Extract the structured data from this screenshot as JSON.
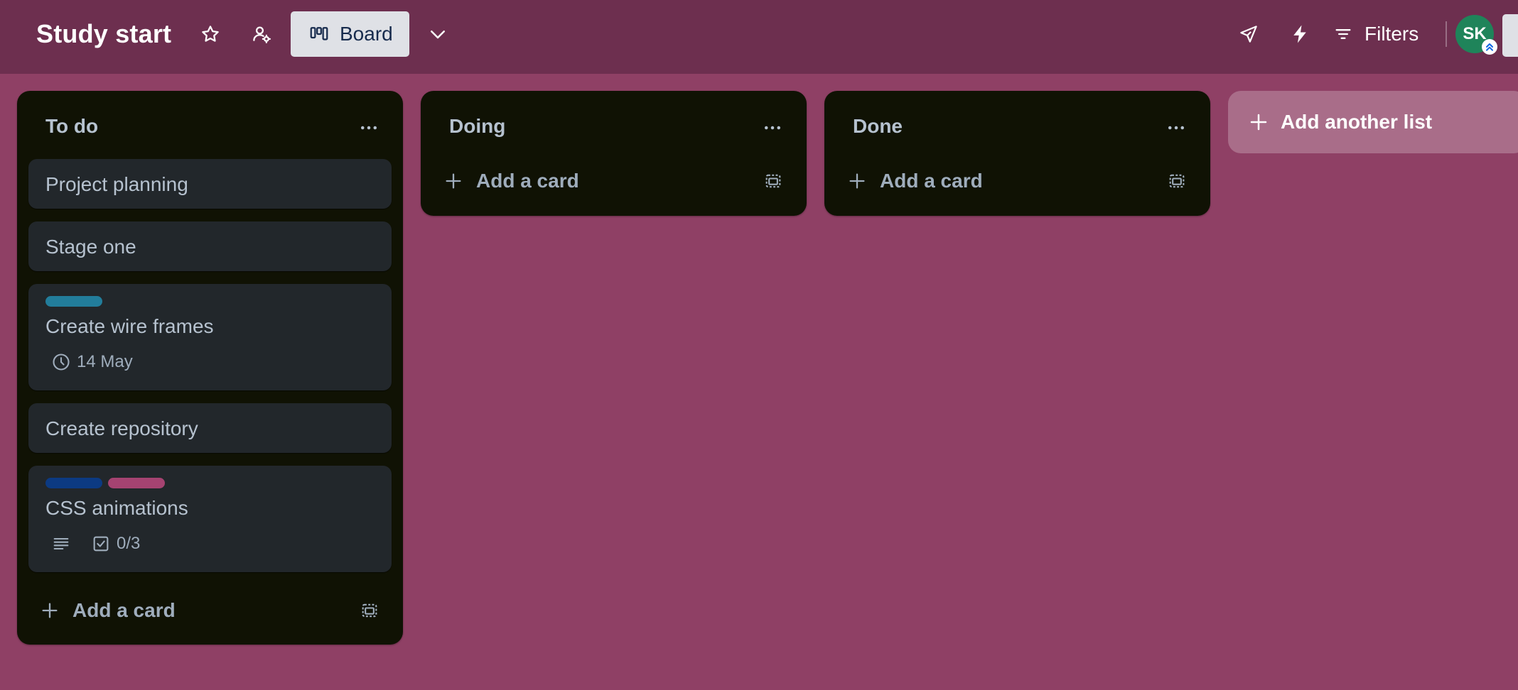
{
  "board": {
    "title": "Study start",
    "view_label": "Board",
    "filters_label": "Filters",
    "avatar_initials": "SK",
    "colors": {
      "header_bg": "#6d2f4f",
      "board_bg": "#8f4065",
      "list_bg": "#101204",
      "card_bg": "#22272b",
      "avatar_bg": "#1f845a"
    }
  },
  "header_icons": [
    "star-icon",
    "workspace-visibility-icon",
    "board-view-icon",
    "chevron-down-icon",
    "rocket-icon",
    "lightning-icon",
    "filter-icon"
  ],
  "lists": [
    {
      "title": "To do",
      "cards": [
        {
          "title": "Project planning"
        },
        {
          "title": "Stage one"
        },
        {
          "title": "Create wire frames",
          "labels": [
            "#227d9b"
          ],
          "due": "14 May"
        },
        {
          "title": "Create repository"
        },
        {
          "title": "CSS animations",
          "labels": [
            "#0c3a82",
            "#a54371"
          ],
          "checklist": "0/3",
          "has_description": true
        }
      ],
      "add_card_label": "Add a card"
    },
    {
      "title": "Doing",
      "cards": [],
      "add_card_label": "Add a card"
    },
    {
      "title": "Done",
      "cards": [],
      "add_card_label": "Add a card"
    }
  ],
  "add_list_label": "Add another list"
}
